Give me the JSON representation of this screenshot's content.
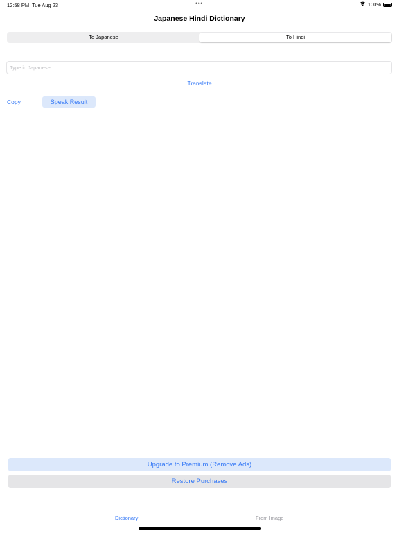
{
  "status_bar": {
    "time": "12:58 PM",
    "date": "Tue Aug 23",
    "dots": "•••",
    "battery": "100%"
  },
  "nav": {
    "title": "Japanese Hindi Dictionary"
  },
  "segmented": {
    "options": [
      "To Japanese",
      "To Hindi"
    ],
    "selected": "To Hindi"
  },
  "input": {
    "placeholder": "Type in Japanese",
    "value": ""
  },
  "actions": {
    "translate": "Translate",
    "copy": "Copy",
    "speak": "Speak Result"
  },
  "bottom_buttons": {
    "premium": "Upgrade to Premium (Remove Ads)",
    "restore": "Restore Purchases"
  },
  "tab_bar": {
    "items": [
      "Dictionary",
      "From Image"
    ],
    "active": "Dictionary"
  },
  "colors": {
    "accent": "#3478f6",
    "button_tint": "#dce8fb",
    "restore_bg": "#e5e5e7"
  },
  "icons": {
    "wifi": "wifi-icon",
    "battery": "battery-icon"
  }
}
